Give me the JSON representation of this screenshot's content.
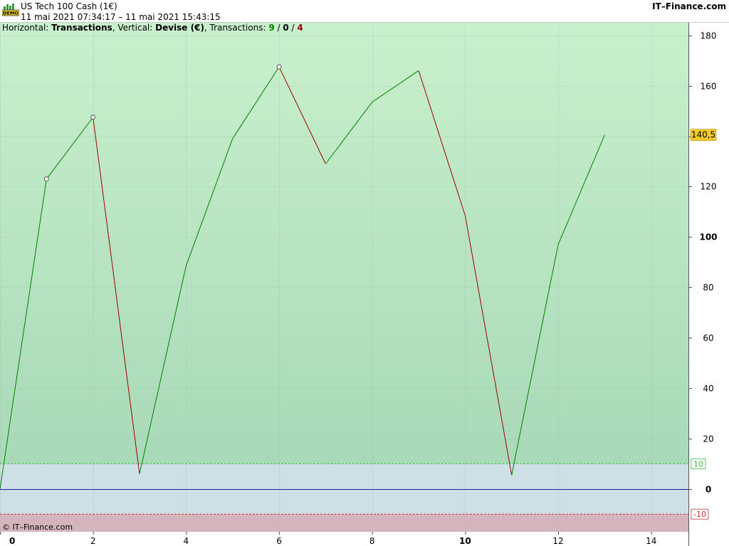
{
  "header": {
    "demo_badge": "DEMO",
    "title": "US Tech 100 Cash (1€)",
    "date_range": "11 mai 2021 07:34:17 – 11 mai 2021 15:43:15",
    "brand": "IT–Finance.com"
  },
  "info_line": {
    "horizontal_label": "Horizontal: ",
    "horizontal_value": "Transactions",
    "vertical_label": ", Vertical: ",
    "vertical_value": "Devise (€)",
    "transactions_label": ", Transactions: ",
    "winning": "9",
    "neutral": "0",
    "losing": "4",
    "sep1": " / ",
    "sep2": " / "
  },
  "copyright": "© IT–Finance.com",
  "colors": {
    "up_line": "#008000",
    "down_line": "#a00000",
    "zero_line": "#1a1aa0",
    "upper_band_line": "#33bb33",
    "lower_band_line": "#cc3333",
    "last_value_bg": "#f4cc2a",
    "winning_text": "#008000",
    "losing_text": "#a00000",
    "neutral_text": "#000000"
  },
  "chart_data": {
    "type": "line",
    "x": [
      0,
      1,
      2,
      3,
      4,
      5,
      6,
      7,
      8,
      9,
      10,
      11,
      12,
      13
    ],
    "y": [
      0,
      123,
      147.5,
      6,
      88.5,
      139,
      167.5,
      129,
      153.5,
      166,
      108.5,
      5.5,
      97,
      140.5
    ],
    "markers": [
      1,
      2,
      6
    ],
    "xlim": [
      0,
      14.8
    ],
    "ylim": [
      -17,
      185
    ],
    "x_ticks": [
      0,
      2,
      4,
      6,
      8,
      10,
      12,
      14
    ],
    "x_tick_labels": [
      "0",
      "2",
      "4",
      "6",
      "8",
      "10",
      "12",
      "14"
    ],
    "bold_x_ticks": [
      0,
      10
    ],
    "y_ticks": [
      0,
      20,
      40,
      60,
      80,
      100,
      120,
      140,
      160,
      180
    ],
    "y_tick_labels": [
      "0",
      "20",
      "40",
      "60",
      "80",
      "100",
      "120",
      "140",
      "160",
      "180"
    ],
    "bold_y_ticks": [
      0,
      100
    ],
    "upper_band": 10,
    "upper_band_label": "10",
    "lower_band": -10,
    "lower_band_label": "-10",
    "last_value": 140.5,
    "last_value_label": "140,5",
    "grid": true
  }
}
